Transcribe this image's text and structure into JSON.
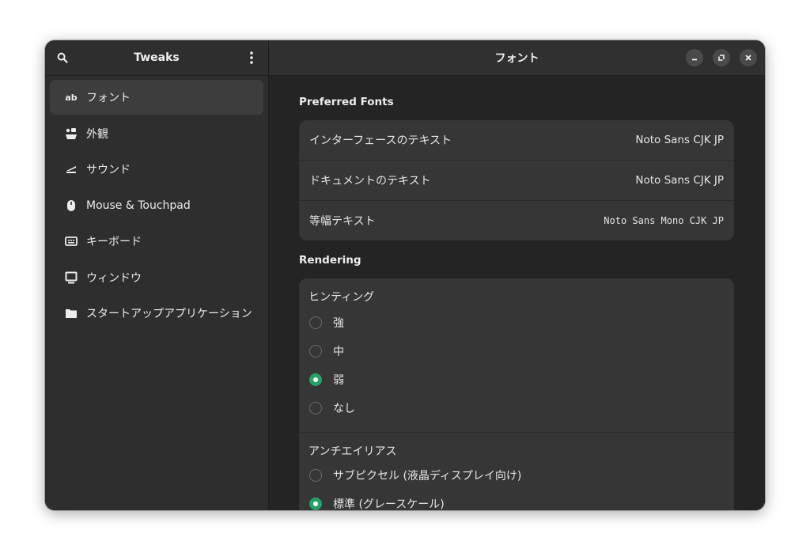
{
  "sidebar": {
    "title": "Tweaks",
    "items": [
      {
        "label": "フォント",
        "icon": "ab",
        "active": true
      },
      {
        "label": "外観",
        "icon": "appearance-icon"
      },
      {
        "label": "サウンド",
        "icon": "sound-icon"
      },
      {
        "label": "Mouse & Touchpad",
        "icon": "mouse-icon"
      },
      {
        "label": "キーボード",
        "icon": "keyboard-icon"
      },
      {
        "label": "ウィンドウ",
        "icon": "window-icon"
      },
      {
        "label": "スタートアップアプリケーション",
        "icon": "folder-icon"
      }
    ]
  },
  "main": {
    "title": "フォント",
    "preferred_fonts": {
      "title": "Preferred Fonts",
      "rows": [
        {
          "label": "インターフェースのテキスト",
          "value": "Noto Sans CJK JP"
        },
        {
          "label": "ドキュメントのテキスト",
          "value": "Noto Sans CJK JP"
        },
        {
          "label": "等幅テキスト",
          "value": "Noto Sans Mono CJK JP"
        }
      ]
    },
    "rendering": {
      "title": "Rendering",
      "hinting": {
        "label": "ヒンティング",
        "options": [
          "強",
          "中",
          "弱",
          "なし"
        ],
        "selected": "弱"
      },
      "antialiasing": {
        "label": "アンチエイリアス",
        "options": [
          "サブピクセル (液晶ディスプレイ向け)",
          "標準 (グレースケール)"
        ],
        "selected": "標準 (グレースケール)"
      }
    }
  },
  "colors": {
    "accent": "#26a269",
    "window_bg": "#242424",
    "sidebar_bg": "#2e2e2e",
    "card_bg": "#363636"
  }
}
